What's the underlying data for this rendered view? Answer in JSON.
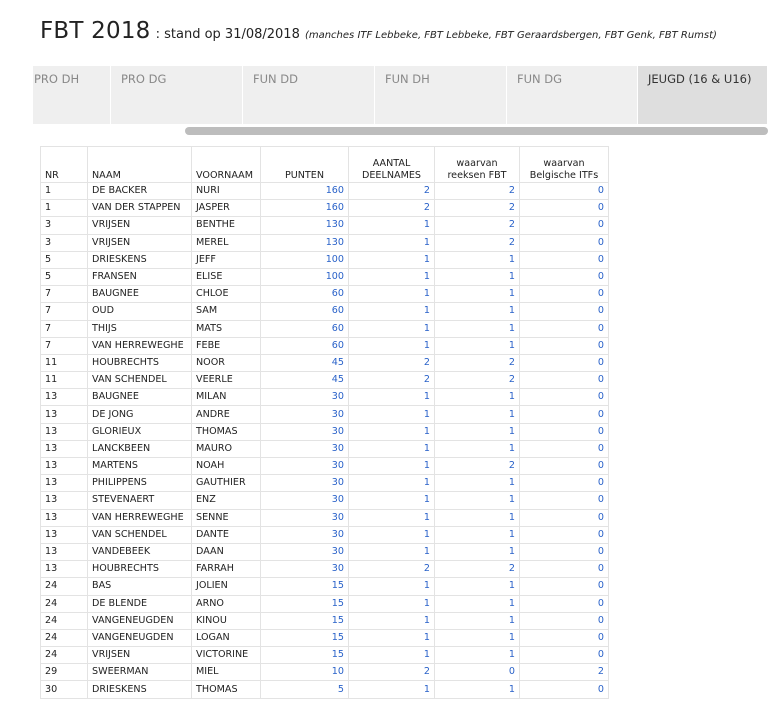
{
  "header": {
    "title": "FBT 2018",
    "subtitle": ": stand op 31/08/2018",
    "note": "(manches ITF Lebbeke, FBT Lebbeke, FBT Geraardsbergen, FBT Genk, FBT Rumst)"
  },
  "tabs": [
    {
      "label": "PRO DH"
    },
    {
      "label": "PRO DG"
    },
    {
      "label": "FUN DD"
    },
    {
      "label": "FUN DH"
    },
    {
      "label": "FUN DG"
    },
    {
      "label": "JEUGD (16 & U16)"
    }
  ],
  "table": {
    "columns": [
      "NR",
      "NAAM",
      "VOORNAAM",
      "PUNTEN",
      "AANTAL DEELNAMES",
      "waarvan reeksen FBT",
      "waarvan Belgische ITFs"
    ],
    "rows": [
      [
        "1",
        "DE BACKER",
        "NURI",
        "160",
        "2",
        "2",
        "0"
      ],
      [
        "1",
        "VAN DER STAPPEN",
        "JASPER",
        "160",
        "2",
        "2",
        "0"
      ],
      [
        "3",
        "VRIJSEN",
        "BENTHE",
        "130",
        "1",
        "2",
        "0"
      ],
      [
        "3",
        "VRIJSEN",
        "MEREL",
        "130",
        "1",
        "2",
        "0"
      ],
      [
        "5",
        "DRIESKENS",
        "JEFF",
        "100",
        "1",
        "1",
        "0"
      ],
      [
        "5",
        "FRANSEN",
        "ELISE",
        "100",
        "1",
        "1",
        "0"
      ],
      [
        "7",
        "BAUGNEE",
        "CHLOE",
        "60",
        "1",
        "1",
        "0"
      ],
      [
        "7",
        "OUD",
        "SAM",
        "60",
        "1",
        "1",
        "0"
      ],
      [
        "7",
        "THIJS",
        "MATS",
        "60",
        "1",
        "1",
        "0"
      ],
      [
        "7",
        "VAN HERREWEGHE",
        "FEBE",
        "60",
        "1",
        "1",
        "0"
      ],
      [
        "11",
        "HOUBRECHTS",
        "NOOR",
        "45",
        "2",
        "2",
        "0"
      ],
      [
        "11",
        "VAN SCHENDEL",
        "VEERLE",
        "45",
        "2",
        "2",
        "0"
      ],
      [
        "13",
        "BAUGNEE",
        "MILAN",
        "30",
        "1",
        "1",
        "0"
      ],
      [
        "13",
        "DE JONG",
        "ANDRE",
        "30",
        "1",
        "1",
        "0"
      ],
      [
        "13",
        "GLORIEUX",
        "THOMAS",
        "30",
        "1",
        "1",
        "0"
      ],
      [
        "13",
        "LANCKBEEN",
        "MAURO",
        "30",
        "1",
        "1",
        "0"
      ],
      [
        "13",
        "MARTENS",
        "NOAH",
        "30",
        "1",
        "2",
        "0"
      ],
      [
        "13",
        "PHILIPPENS",
        "GAUTHIER",
        "30",
        "1",
        "1",
        "0"
      ],
      [
        "13",
        "STEVENAERT",
        "ENZ",
        "30",
        "1",
        "1",
        "0"
      ],
      [
        "13",
        "VAN HERREWEGHE",
        "SENNE",
        "30",
        "1",
        "1",
        "0"
      ],
      [
        "13",
        "VAN SCHENDEL",
        "DANTE",
        "30",
        "1",
        "1",
        "0"
      ],
      [
        "13",
        "VANDEBEEK",
        "DAAN",
        "30",
        "1",
        "1",
        "0"
      ],
      [
        "13",
        "HOUBRECHTS",
        "FARRAH",
        "30",
        "2",
        "2",
        "0"
      ],
      [
        "24",
        "BAS",
        "JOLIEN",
        "15",
        "1",
        "1",
        "0"
      ],
      [
        "24",
        "DE BLENDE",
        "ARNO",
        "15",
        "1",
        "1",
        "0"
      ],
      [
        "24",
        "VANGENEUGDEN",
        "KINOU",
        "15",
        "1",
        "1",
        "0"
      ],
      [
        "24",
        "VANGENEUGDEN",
        "LOGAN",
        "15",
        "1",
        "1",
        "0"
      ],
      [
        "24",
        "VRIJSEN",
        "VICTORINE",
        "15",
        "1",
        "1",
        "0"
      ],
      [
        "29",
        "SWEERMAN",
        "MIEL",
        "10",
        "2",
        "0",
        "2"
      ],
      [
        "30",
        "DRIESKENS",
        "THOMAS",
        "5",
        "1",
        "1",
        "0"
      ]
    ]
  }
}
